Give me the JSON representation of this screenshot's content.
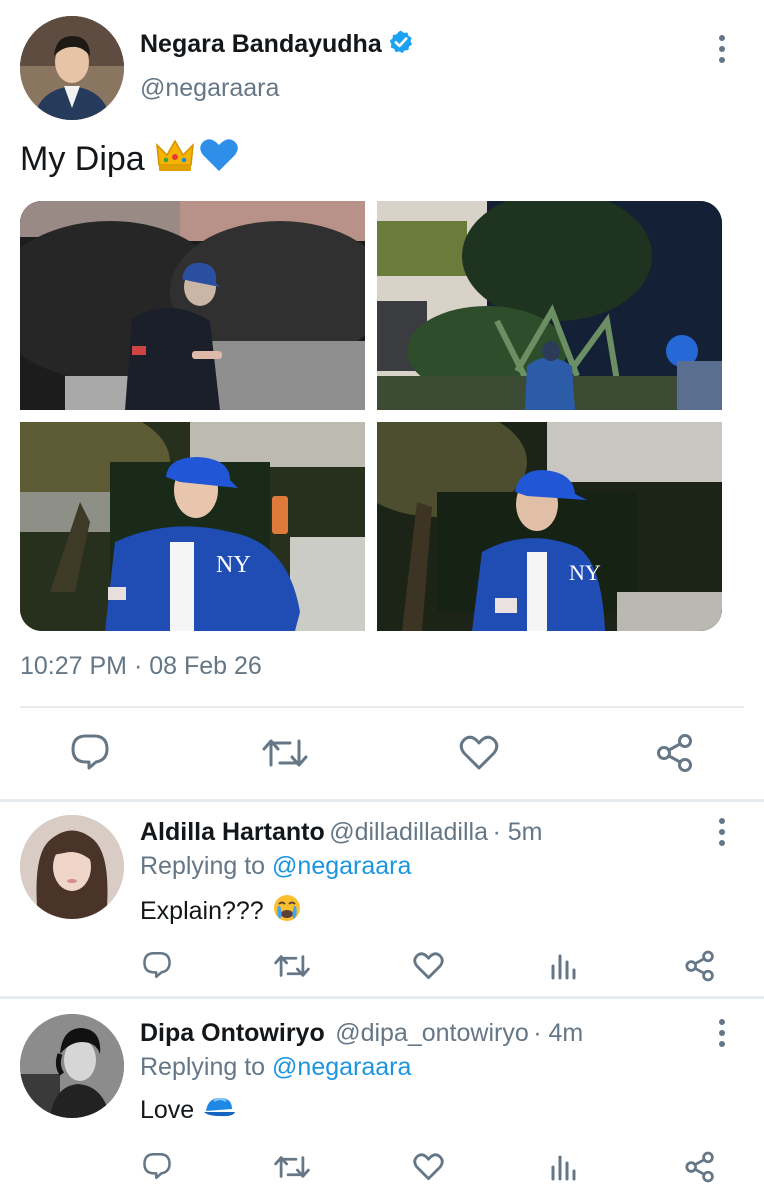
{
  "tweet": {
    "author_name": "Negara Bandayudha",
    "author_handle": "@negaraara",
    "text": "My Dipa",
    "text_emojis": [
      "crown-emoji",
      "blue-heart-emoji"
    ],
    "timestamp": "10:27 PM · 08 Feb 26",
    "verified": true,
    "photo_count": 4,
    "actions": [
      "reply-icon",
      "retweet-icon",
      "like-icon",
      "share-icon"
    ]
  },
  "replies": [
    {
      "author_name": "Aldilla Hartanto",
      "author_handle": "@dilladilladilla",
      "time": "· 5m",
      "replying_prefix": "Replying to",
      "replying_to": "@negaraara",
      "text": "Explain???",
      "emoji": "crying-face-emoji",
      "actions": [
        "reply-icon",
        "retweet-icon",
        "like-icon",
        "analytics-icon",
        "share-icon"
      ]
    },
    {
      "author_name": "Dipa Ontowiryo",
      "author_handle": "@dipa_ontowiryo",
      "time": "· 4m",
      "replying_prefix": "Replying to",
      "replying_to": "@negaraara",
      "text": "Love",
      "emoji": "blue-cap-emoji",
      "actions": [
        "reply-icon",
        "retweet-icon",
        "like-icon",
        "analytics-icon",
        "share-icon"
      ]
    }
  ],
  "colors": {
    "link_blue": "#1b95e0",
    "verified_blue": "#1da1f2",
    "muted_gray": "#657786",
    "divider": "#e6ecf0"
  }
}
